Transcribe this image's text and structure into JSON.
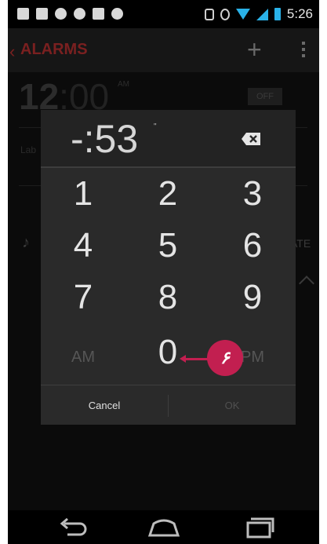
{
  "status_bar": {
    "time": "5:26",
    "left_icons": [
      "sim-icon",
      "download-icon",
      "chat-icon",
      "check-icon",
      "image-icon",
      "android-icon"
    ],
    "right_icons": [
      "bluetooth-icon",
      "sync-icon",
      "wifi-icon",
      "signal-icon",
      "battery-icon"
    ],
    "accent_color": "#2ab2e8"
  },
  "action_bar": {
    "title": "ALARMS",
    "add_icon": "plus-icon",
    "menu_icon": "overflow-menu-icon",
    "title_color": "#7a2020"
  },
  "background_alarm": {
    "hour": "12",
    "minutes": ":00",
    "ampm": "AM",
    "toggle": "OFF",
    "label_snippet": "Lab",
    "vibrate_snippet": "ATE"
  },
  "dialog": {
    "display": "-:53",
    "display_suffix": "\"",
    "keys": [
      "1",
      "2",
      "3",
      "4",
      "5",
      "6",
      "7",
      "8",
      "9"
    ],
    "am": "AM",
    "zero": "0",
    "pm": "PM",
    "cancel": "Cancel",
    "ok": "OK"
  },
  "callout": {
    "text": "۶",
    "color": "#c21f50"
  },
  "nav_bar": {
    "icons": [
      "back-icon",
      "home-icon",
      "recent-apps-icon"
    ]
  }
}
